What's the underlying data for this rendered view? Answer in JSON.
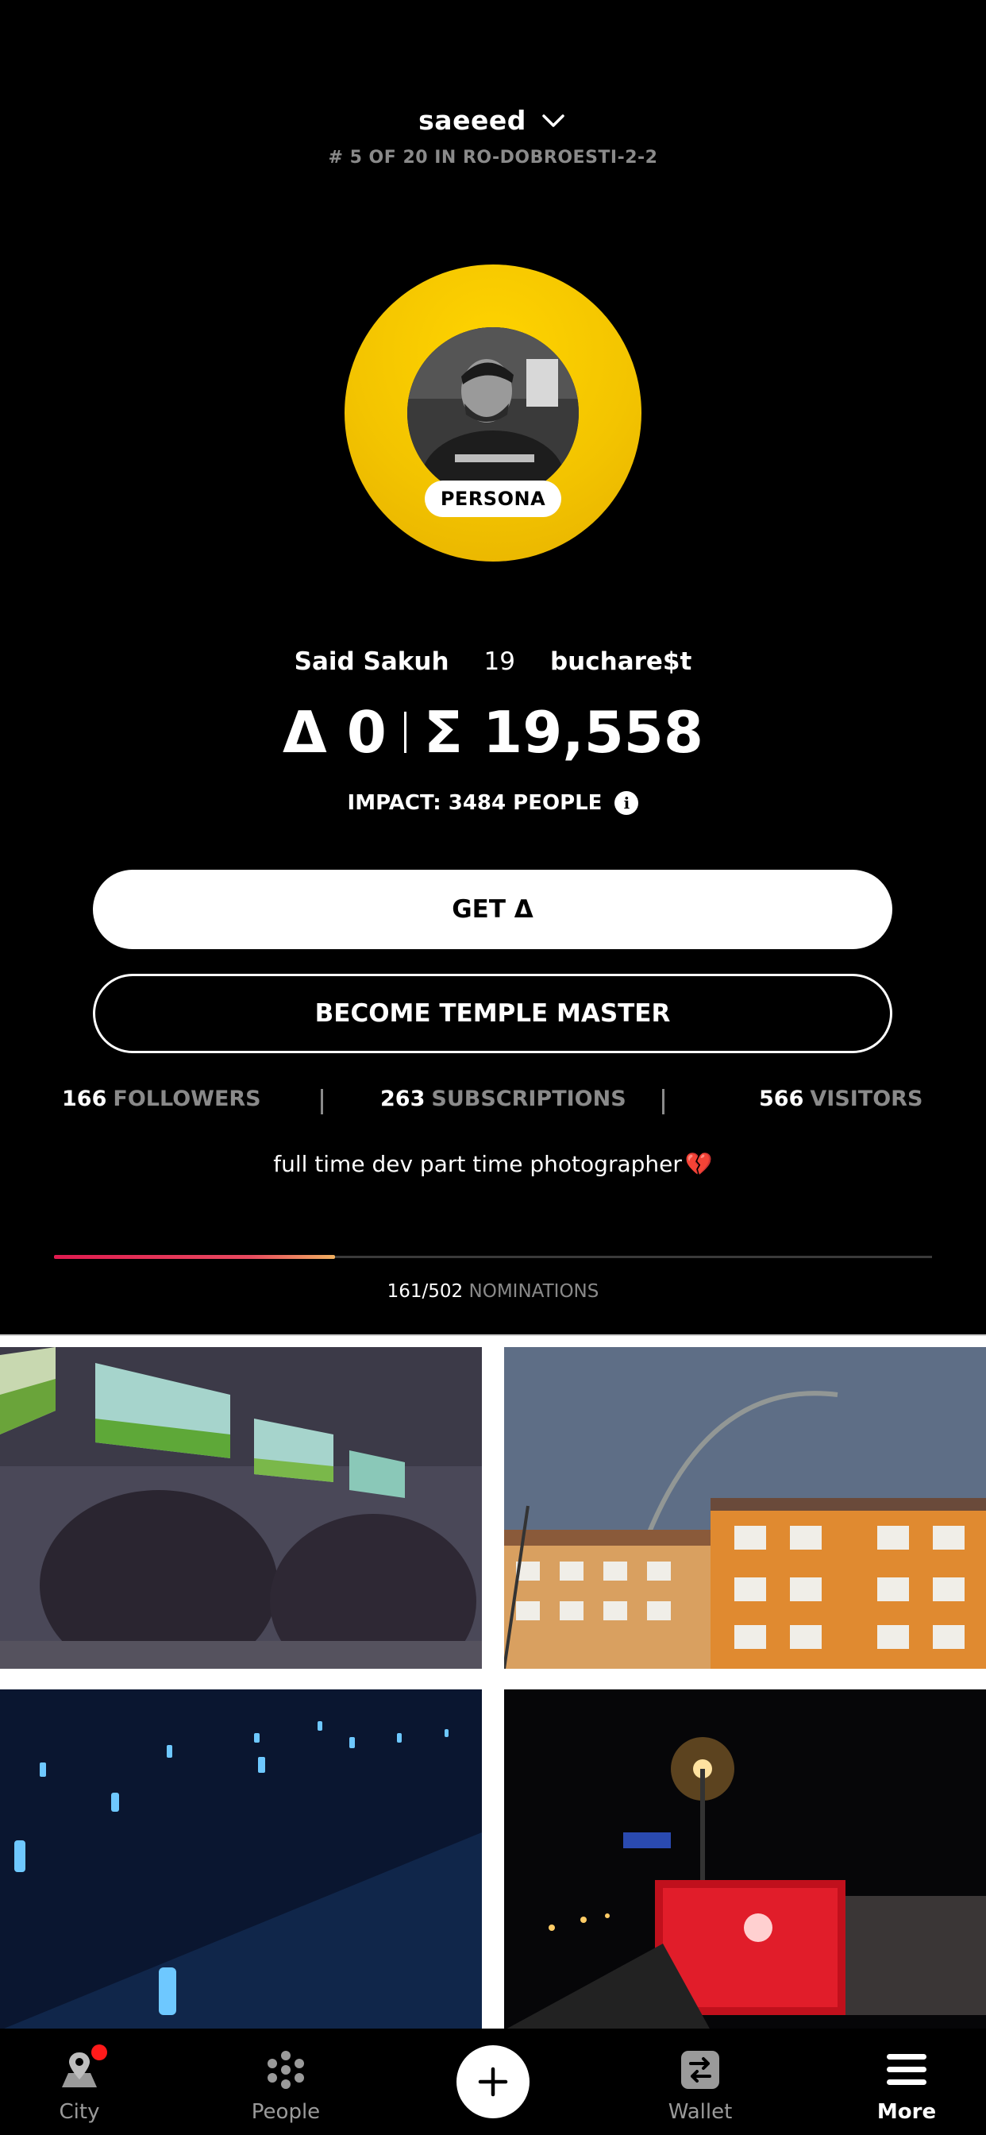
{
  "header": {
    "username": "saeeed",
    "rank": "# 5 OF 20 IN RO-DOBROESTI-2-2"
  },
  "profile": {
    "badge": "PERSONA",
    "name": "Said Sakuh",
    "age": "19",
    "city": "buchare$t",
    "delta_balance": "Δ 0",
    "xi_balance": "Ʃ 19,558",
    "impact": "IMPACT: 3484 PEOPLE",
    "bio": "full time dev part time photographer",
    "bio_emoji": "💔"
  },
  "buttons": {
    "get": "GET Δ",
    "temple": "BECOME TEMPLE MASTER"
  },
  "stats": {
    "followers_count": "166",
    "followers_label": "FOLLOWERS",
    "subscriptions_count": "263",
    "subscriptions_label": "SUBSCRIPTIONS",
    "visitors_count": "566",
    "visitors_label": "VISITORS"
  },
  "nominations": {
    "count": "161/502",
    "label": "NOMINATIONS",
    "progress": 0.32
  },
  "gallery": {
    "photos": [
      "aquarium-interior-photo",
      "rainbow-apartment-blocks-photo",
      "blue-garden-lights-photo",
      "red-bus-stop-night-photo"
    ]
  },
  "tabbar": {
    "city": "City",
    "people": "People",
    "wallet": "Wallet",
    "more": "More",
    "active": "More"
  },
  "colors": {
    "accent_yellow": "#f5c800",
    "progress_red": "#e01a4f",
    "notification": "#ff1a1a"
  }
}
